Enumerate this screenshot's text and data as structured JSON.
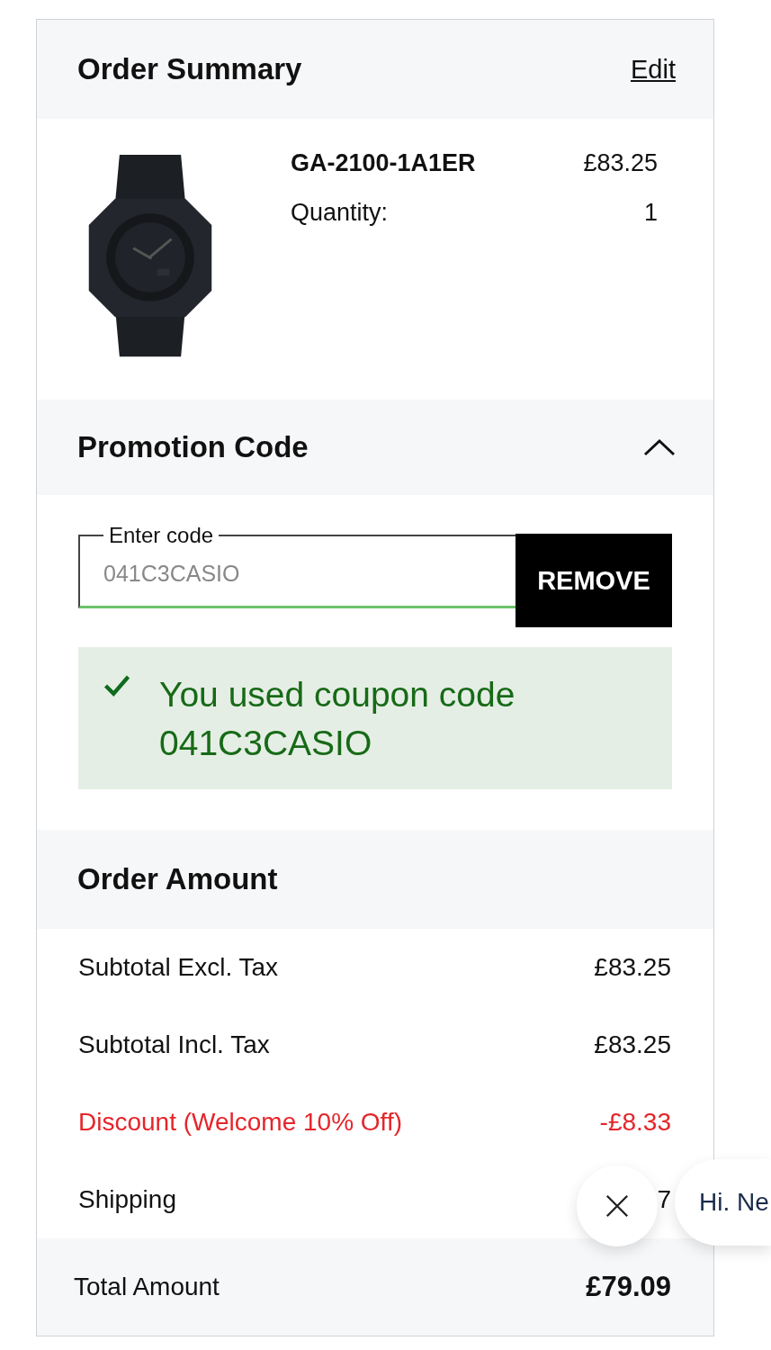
{
  "order_summary": {
    "title": "Order Summary",
    "edit_link": "Edit"
  },
  "product": {
    "kind": "picture",
    "name": "GA-2100-1A1ER",
    "price": "£83.25",
    "quantity_label": "Quantity:",
    "quantity": "1"
  },
  "promotion": {
    "title": "Promotion Code",
    "expanded": true,
    "field": {
      "label": "Enter code",
      "value": "041C3CASIO",
      "valid": true
    },
    "button": "REMOVE",
    "message": "You used coupon code 041C3CASIO"
  },
  "order_amount": {
    "title": "Order Amount",
    "rows": [
      {
        "kind": "normal",
        "label": "Subtotal Excl. Tax",
        "value": "£83.25"
      },
      {
        "kind": "normal",
        "label": "Subtotal Incl. Tax",
        "value": "£83.25"
      },
      {
        "kind": "discount",
        "label": "Discount (Welcome 10% Off)",
        "value": "-£8.33"
      },
      {
        "kind": "normal",
        "label": "Shipping",
        "value": "7"
      }
    ],
    "total": {
      "label": "Total Amount",
      "value": "£79.09"
    }
  },
  "chat": {
    "greeting": "Hi. Ne"
  }
}
